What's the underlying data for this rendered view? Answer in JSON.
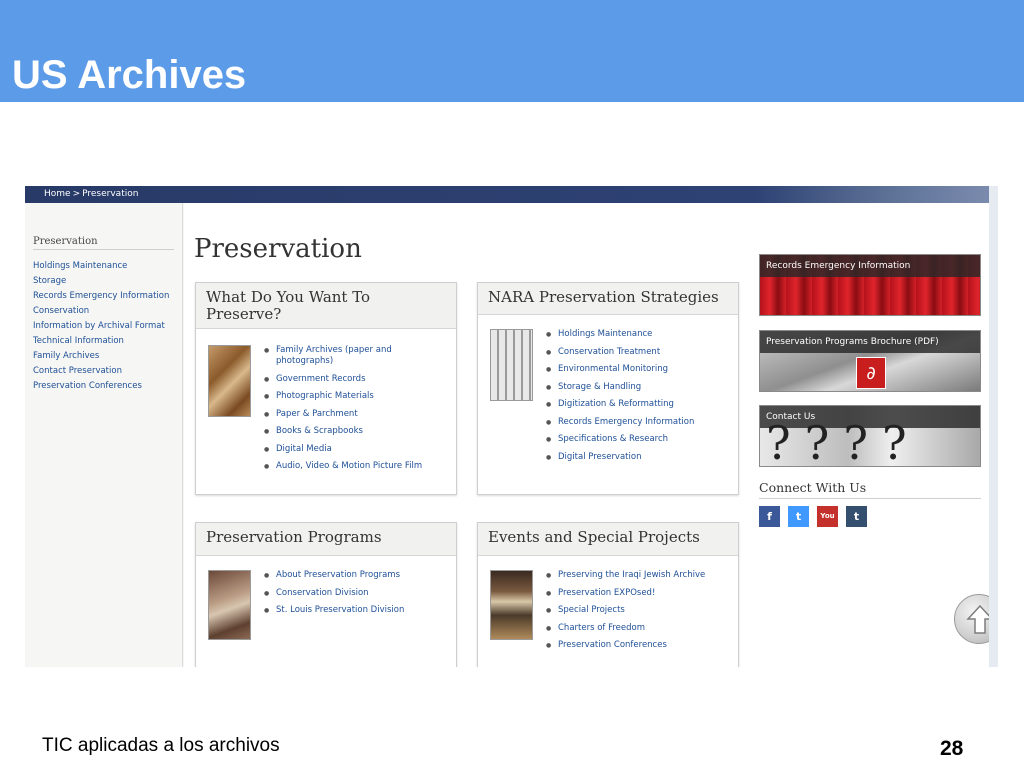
{
  "slide": {
    "title": "US Archives",
    "footer_text": "TIC aplicadas a los archivos",
    "page_number": "28",
    "header_color": "#5b9be8"
  },
  "site": {
    "breadcrumb": {
      "home": "Home",
      "separator": ">",
      "current": "Preservation"
    },
    "sidebar": {
      "heading": "Preservation",
      "items": [
        "Holdings Maintenance",
        "Storage",
        "Records Emergency Information",
        "Conservation",
        "Information by Archival Format",
        "Technical Information",
        "Family Archives",
        "Contact Preservation",
        "Preservation Conferences"
      ]
    },
    "page_title": "Preservation",
    "cards": {
      "what": {
        "title": "What Do You Want To Preserve?",
        "items": [
          "Family Archives (paper and photographs)",
          "Government Records",
          "Photographic Materials",
          "Paper & Parchment",
          "Books & Scrapbooks",
          "Digital Media",
          "Audio, Video & Motion Picture Film"
        ]
      },
      "strategies": {
        "title": "NARA Preservation Strategies",
        "items": [
          "Holdings Maintenance",
          "Conservation Treatment",
          "Environmental Monitoring",
          "Storage & Handling",
          "Digitization & Reformatting",
          "Records Emergency Information",
          "Specifications & Research",
          "Digital Preservation"
        ]
      },
      "programs": {
        "title": "Preservation Programs",
        "items": [
          "About Preservation Programs",
          "Conservation Division",
          "St. Louis Preservation Division"
        ]
      },
      "events": {
        "title": "Events and Special Projects",
        "items": [
          "Preserving the Iraqi Jewish Archive",
          "Preservation EXPOsed!",
          "Special Projects",
          "Charters of Freedom",
          "Preservation Conferences"
        ]
      }
    },
    "promos": {
      "emergency": "Records Emergency Information",
      "brochure": "Preservation Programs Brochure (PDF)",
      "contact": "Contact Us"
    },
    "connect": {
      "heading": "Connect With Us",
      "icons": [
        {
          "name": "facebook-icon",
          "glyph": "f",
          "color": "#3b5998"
        },
        {
          "name": "twitter-icon",
          "glyph": "t",
          "color": "#4099ff"
        },
        {
          "name": "youtube-icon",
          "glyph": "You",
          "color": "#c4302b"
        },
        {
          "name": "tumblr-icon",
          "glyph": "t",
          "color": "#35506e"
        }
      ]
    }
  }
}
